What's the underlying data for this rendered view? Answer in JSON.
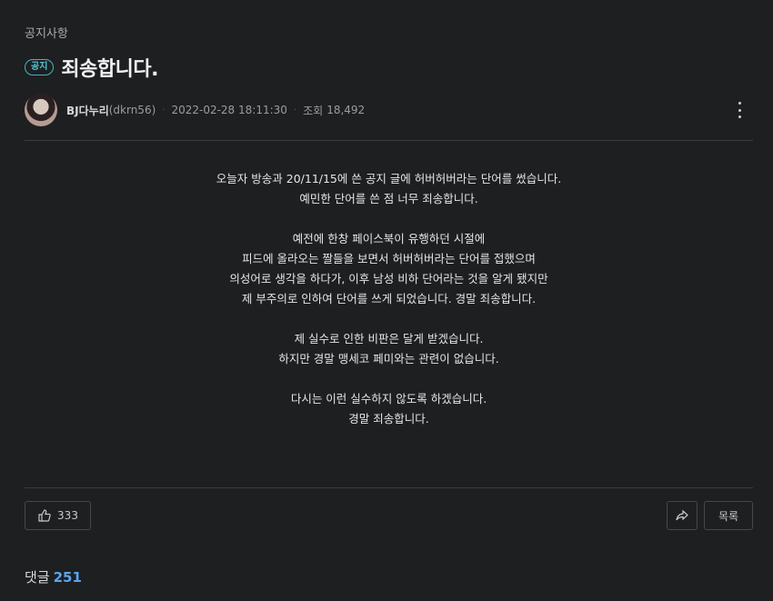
{
  "post": {
    "category": "공지사항",
    "badge": "공지",
    "title": "죄송합니다.",
    "author_name": "BJ다누리",
    "author_id": "(dkrn56)",
    "datetime": "2022-02-28 18:11:30",
    "views_label": "조회",
    "views": "18,492"
  },
  "body": {
    "paragraphs": [
      [
        "오늘자 방송과 20/11/15에 쓴 공지 글에 허버허버라는 단어를 썼습니다.",
        "예민한 단어를 쓴 점 너무 죄송합니다."
      ],
      [
        "예전에 한창 페이스북이 유행하던 시절에",
        "피드에 올라오는 짤들을 보면서 허버허버라는 단어를 접했으며",
        "의성어로 생각을 하다가, 이후 남성 비하 단어라는 것을 알게 됐지만",
        "제 부주의로 인하여 단어를 쓰게 되었습니다. 경말 죄송합니다."
      ],
      [
        "제 실수로 인한 비판은 달게 받겠습니다.",
        "하지만 경말 맹세코 페미와는 관련이 없습니다."
      ],
      [
        "다시는 이런 실수하지 않도록 하겠습니다.",
        "경말 죄송합니다."
      ]
    ]
  },
  "actions": {
    "like_count": "333",
    "list_label": "목록"
  },
  "comments": {
    "label": "댓글",
    "count": "251"
  },
  "icons": {
    "like": "thumbs-up-icon",
    "share": "share-icon",
    "more": "more-vertical-icon"
  },
  "colors": {
    "background": "#1e1f21",
    "badge": "#52c9d8",
    "comment_count": "#5aa6f0"
  }
}
